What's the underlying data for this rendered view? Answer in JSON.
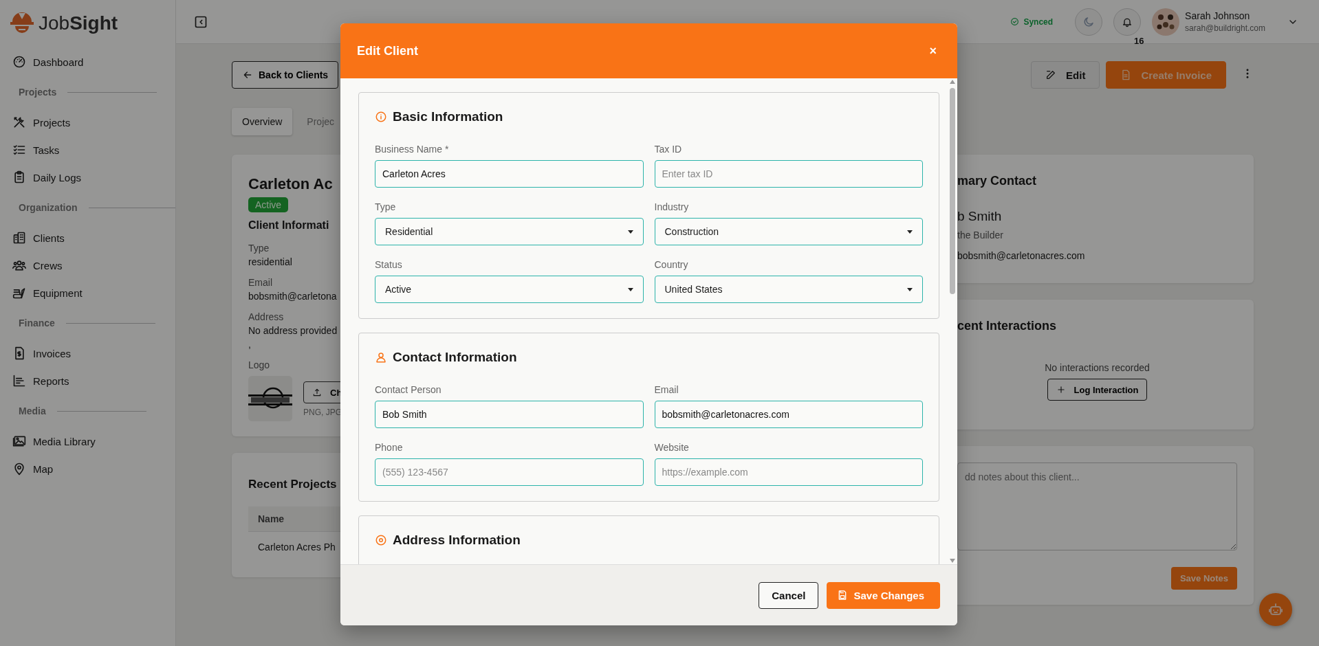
{
  "sidebar": {
    "logo": "Job**Sight**",
    "nav": [
      {
        "kind": "link",
        "label": "Dashboard"
      },
      {
        "kind": "section",
        "label": "Projects"
      },
      {
        "kind": "link",
        "label": "Projects"
      },
      {
        "kind": "link",
        "label": "Tasks"
      },
      {
        "kind": "link",
        "label": "Daily Logs"
      },
      {
        "kind": "section",
        "label": "Organization"
      },
      {
        "kind": "link",
        "label": "Clients"
      },
      {
        "kind": "link",
        "label": "Crews"
      },
      {
        "kind": "link",
        "label": "Equipment"
      },
      {
        "kind": "section",
        "label": "Finance"
      },
      {
        "kind": "link",
        "label": "Invoices"
      },
      {
        "kind": "link",
        "label": "Reports"
      },
      {
        "kind": "section",
        "label": "Media"
      },
      {
        "kind": "link",
        "label": "Media Library"
      },
      {
        "kind": "link",
        "label": "Map"
      }
    ]
  },
  "topbar": {
    "sync_status": "Synced",
    "notification_count": "16",
    "user": {
      "name": "Sarah Johnson",
      "email": "sarah@buildright.com"
    }
  },
  "page": {
    "back_button": "Back to Clients",
    "actions": [
      {
        "kind": "secondary",
        "label": "Edit"
      },
      {
        "kind": "primary",
        "label": "Create Invoice"
      }
    ],
    "tabs": [
      {
        "label": "Overview",
        "selected": true
      },
      {
        "label": "Projec",
        "selected": false
      }
    ],
    "client_card": {
      "title": "Carleton Ac",
      "status": "Active",
      "section_title": "Client Informati",
      "fields": [
        {
          "label": "Type",
          "lines": [
            "residential"
          ]
        },
        {
          "label": "Email",
          "lines": [
            "bobsmith@carletona"
          ]
        },
        {
          "label": "Address",
          "lines": [
            "No address provided",
            ","
          ]
        }
      ],
      "logo_label": "Logo",
      "upload_button": "Ch",
      "upload_hint": "PNG, JPG"
    },
    "recent_projects": {
      "title": "Recent Projects",
      "columns": [
        "Name"
      ],
      "rows": [
        [
          "Carleton Acres Ph"
        ]
      ]
    },
    "primary_contact": {
      "title": "mary Contact",
      "name": "b Smith",
      "role": "the Builder",
      "email": "bobsmith@carletonacres.com"
    },
    "interactions": {
      "title": "cent Interactions",
      "empty": "No interactions recorded",
      "button": "Log Interaction"
    },
    "notes": {
      "placeholder": "dd notes about this client...",
      "button": "Save Notes"
    }
  },
  "modal": {
    "title": "Edit Client",
    "close": "×",
    "sections": [
      {
        "title": "Basic Information",
        "fields": [
          {
            "kind": "text",
            "label": "Business Name *",
            "value": "Carleton Acres"
          },
          {
            "kind": "text",
            "label": "Tax ID",
            "placeholder": "Enter tax ID"
          },
          {
            "kind": "select",
            "label": "Type",
            "value": "Residential"
          },
          {
            "kind": "select",
            "label": "Industry",
            "value": "Construction"
          },
          {
            "kind": "select",
            "label": "Status",
            "value": "Active"
          },
          {
            "kind": "select",
            "label": "Country",
            "value": "United States"
          }
        ]
      },
      {
        "title": "Contact Information",
        "fields": [
          {
            "kind": "text",
            "label": "Contact Person",
            "value": "Bob Smith"
          },
          {
            "kind": "text",
            "label": "Email",
            "value": "bobsmith@carletonacres.com"
          },
          {
            "kind": "text",
            "label": "Phone",
            "placeholder": "(555) 123-4567"
          },
          {
            "kind": "text",
            "label": "Website",
            "placeholder": "https://example.com"
          }
        ]
      },
      {
        "title": "Address Information"
      }
    ],
    "buttons": [
      {
        "kind": "secondary",
        "label": "Cancel"
      },
      {
        "kind": "primary",
        "label": "Save Changes"
      }
    ]
  }
}
